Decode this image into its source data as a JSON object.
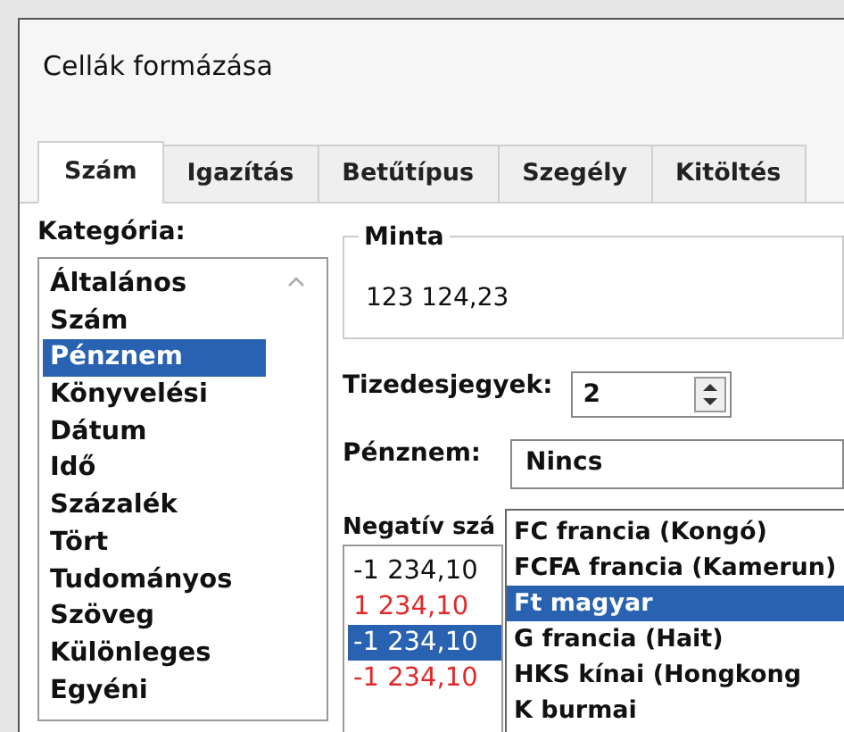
{
  "window": {
    "title": "Cellák formázása"
  },
  "tabs": [
    {
      "label": "Szám",
      "selected": true
    },
    {
      "label": "Igazítás",
      "selected": false
    },
    {
      "label": "Betűtípus",
      "selected": false
    },
    {
      "label": "Szegély",
      "selected": false
    },
    {
      "label": "Kitöltés",
      "selected": false
    }
  ],
  "category": {
    "label": "Kategória:",
    "items": [
      {
        "label": "Általános",
        "selected": false
      },
      {
        "label": "Szám",
        "selected": false
      },
      {
        "label": "Pénznem",
        "selected": true
      },
      {
        "label": "Könyvelési",
        "selected": false
      },
      {
        "label": "Dátum",
        "selected": false
      },
      {
        "label": "Idő",
        "selected": false
      },
      {
        "label": "Százalék",
        "selected": false
      },
      {
        "label": "Tört",
        "selected": false
      },
      {
        "label": "Tudományos",
        "selected": false
      },
      {
        "label": "Szöveg",
        "selected": false
      },
      {
        "label": "Különleges",
        "selected": false
      },
      {
        "label": "Egyéni",
        "selected": false
      }
    ]
  },
  "sample": {
    "label": "Minta",
    "value": "123 124,23"
  },
  "decimals": {
    "label": "Tizedesjegyek:",
    "value": "2"
  },
  "currency": {
    "label": "Pénznem:",
    "value": "Nincs",
    "options": [
      {
        "label": "FC francia (Kongó)",
        "selected": false
      },
      {
        "label": "FCFA francia (Kamerun)",
        "selected": false
      },
      {
        "label": "Ft magyar",
        "selected": true
      },
      {
        "label": "G francia (Hait)",
        "selected": false
      },
      {
        "label": "HKS kínai (Hongkong",
        "selected": false
      },
      {
        "label": "K burmai",
        "selected": false
      }
    ]
  },
  "negative": {
    "label": "Negatív szá",
    "items": [
      {
        "label": "-1 234,10",
        "color": "#111111",
        "selected": false
      },
      {
        "label": "1 234,10",
        "color": "#e02a2a",
        "selected": false
      },
      {
        "label": "-1 234,10",
        "selected": true
      },
      {
        "label": "-1 234,10",
        "color": "#e02a2a",
        "selected": false
      }
    ]
  }
}
